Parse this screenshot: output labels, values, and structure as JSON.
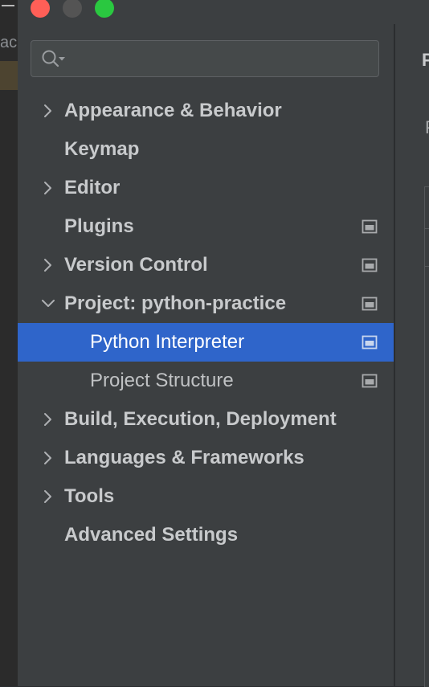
{
  "search": {
    "placeholder": "",
    "value": ""
  },
  "background_fragment": "ac",
  "right_pane": {
    "title_fragment": "P",
    "subtitle_fragment": "P"
  },
  "tree": {
    "items": [
      {
        "label": "Appearance & Behavior",
        "expandable": true,
        "expanded": false,
        "level": 0,
        "badge": false,
        "selected": false
      },
      {
        "label": "Keymap",
        "expandable": false,
        "expanded": false,
        "level": 0,
        "badge": false,
        "selected": false
      },
      {
        "label": "Editor",
        "expandable": true,
        "expanded": false,
        "level": 0,
        "badge": false,
        "selected": false
      },
      {
        "label": "Plugins",
        "expandable": false,
        "expanded": false,
        "level": 0,
        "badge": true,
        "selected": false
      },
      {
        "label": "Version Control",
        "expandable": true,
        "expanded": false,
        "level": 0,
        "badge": true,
        "selected": false
      },
      {
        "label": "Project: python-practice",
        "expandable": true,
        "expanded": true,
        "level": 0,
        "badge": true,
        "selected": false
      },
      {
        "label": "Python Interpreter",
        "expandable": false,
        "expanded": false,
        "level": 1,
        "badge": true,
        "selected": true
      },
      {
        "label": "Project Structure",
        "expandable": false,
        "expanded": false,
        "level": 1,
        "badge": true,
        "selected": false
      },
      {
        "label": "Build, Execution, Deployment",
        "expandable": true,
        "expanded": false,
        "level": 0,
        "badge": false,
        "selected": false
      },
      {
        "label": "Languages & Frameworks",
        "expandable": true,
        "expanded": false,
        "level": 0,
        "badge": false,
        "selected": false
      },
      {
        "label": "Tools",
        "expandable": true,
        "expanded": false,
        "level": 0,
        "badge": false,
        "selected": false
      },
      {
        "label": "Advanced Settings",
        "expandable": false,
        "expanded": false,
        "level": 0,
        "badge": false,
        "selected": false
      }
    ]
  },
  "colors": {
    "selection": "#2f65ca",
    "sidebar_bg": "#3c3f41",
    "text": "#c8cacc",
    "traffic_red": "#ff5f57",
    "traffic_yellow_inactive": "#545454",
    "traffic_green": "#2ac840"
  }
}
